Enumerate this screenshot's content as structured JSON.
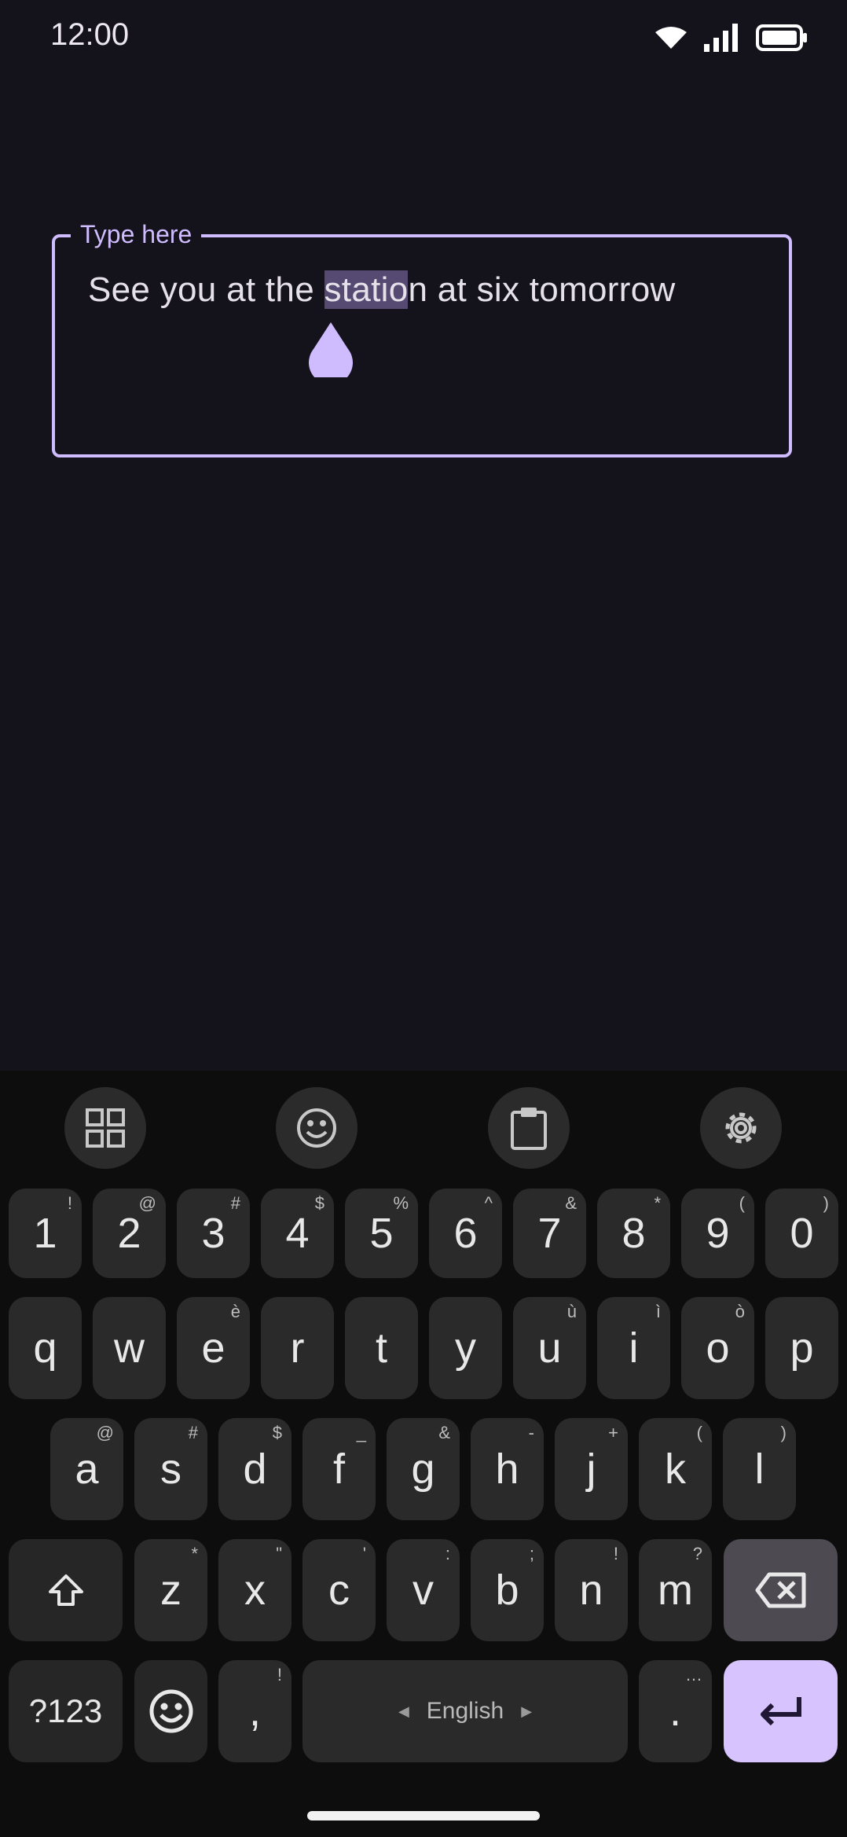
{
  "status": {
    "time": "12:00"
  },
  "field": {
    "label": "Type here",
    "text_before": "See you at the ",
    "text_selected": "statio",
    "text_after": "n at six tomorrow"
  },
  "toolbar": [
    "apps-grid-icon",
    "emoji-icon",
    "clipboard-icon",
    "settings-icon"
  ],
  "keyboard": {
    "row_numbers": [
      {
        "main": "1",
        "hint": "!"
      },
      {
        "main": "2",
        "hint": "@"
      },
      {
        "main": "3",
        "hint": "#"
      },
      {
        "main": "4",
        "hint": "$"
      },
      {
        "main": "5",
        "hint": "%"
      },
      {
        "main": "6",
        "hint": "^"
      },
      {
        "main": "7",
        "hint": "&"
      },
      {
        "main": "8",
        "hint": "*"
      },
      {
        "main": "9",
        "hint": "("
      },
      {
        "main": "0",
        "hint": ")"
      }
    ],
    "row_top": [
      {
        "main": "q",
        "hint": ""
      },
      {
        "main": "w",
        "hint": ""
      },
      {
        "main": "e",
        "hint": "è"
      },
      {
        "main": "r",
        "hint": ""
      },
      {
        "main": "t",
        "hint": ""
      },
      {
        "main": "y",
        "hint": ""
      },
      {
        "main": "u",
        "hint": "ù"
      },
      {
        "main": "i",
        "hint": "ì"
      },
      {
        "main": "o",
        "hint": "ò"
      },
      {
        "main": "p",
        "hint": ""
      }
    ],
    "row_home": [
      {
        "main": "a",
        "hint": "@"
      },
      {
        "main": "s",
        "hint": "#"
      },
      {
        "main": "d",
        "hint": "$"
      },
      {
        "main": "f",
        "hint": "_"
      },
      {
        "main": "g",
        "hint": "&"
      },
      {
        "main": "h",
        "hint": "-"
      },
      {
        "main": "j",
        "hint": "+"
      },
      {
        "main": "k",
        "hint": "("
      },
      {
        "main": "l",
        "hint": ")"
      }
    ],
    "row_bottom": [
      {
        "main": "z",
        "hint": "*"
      },
      {
        "main": "x",
        "hint": "\""
      },
      {
        "main": "c",
        "hint": "'"
      },
      {
        "main": "v",
        "hint": ":"
      },
      {
        "main": "b",
        "hint": ";"
      },
      {
        "main": "n",
        "hint": "!"
      },
      {
        "main": "m",
        "hint": "?"
      }
    ],
    "symbols_label": "?123",
    "comma": {
      "main": ",",
      "hint": "!"
    },
    "space_label": "English",
    "period": {
      "main": ".",
      "hint": "…"
    }
  }
}
